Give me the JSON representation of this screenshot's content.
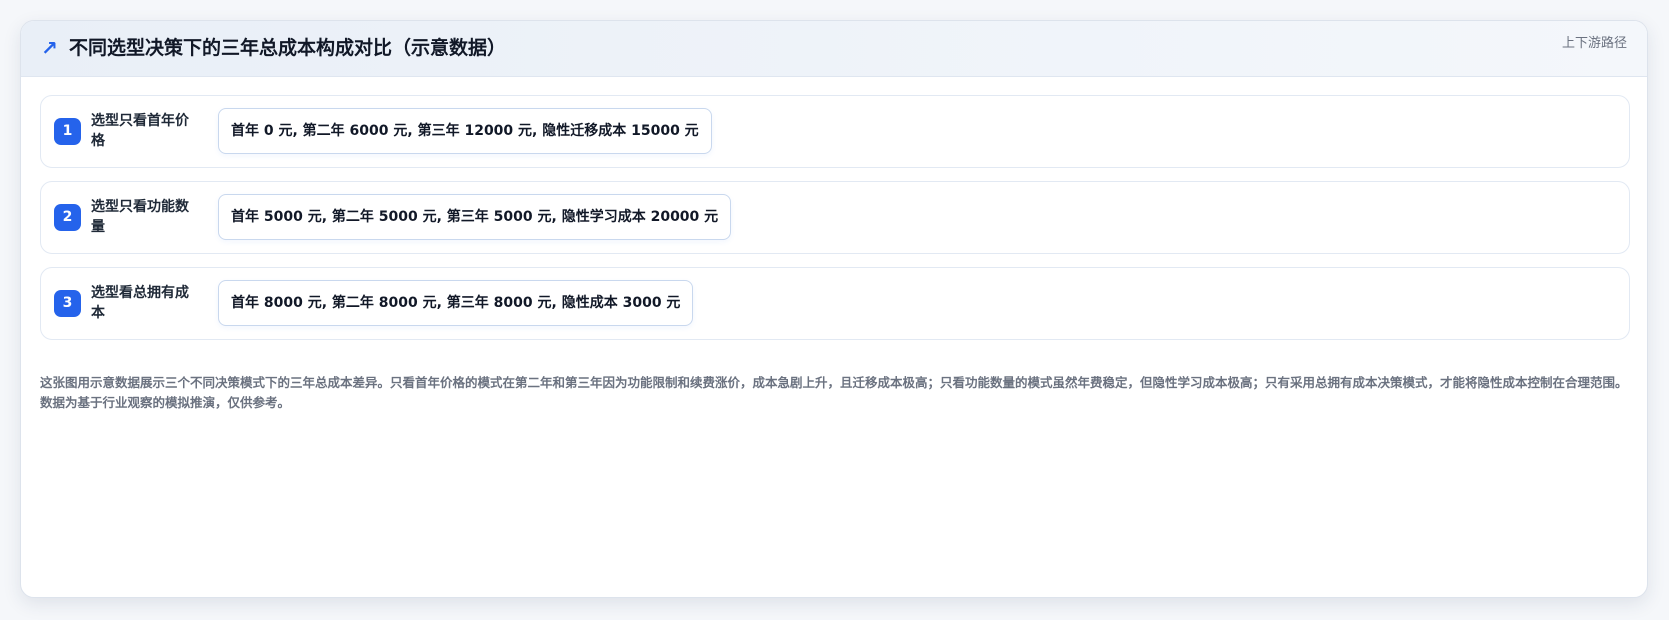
{
  "header": {
    "icon": "trend-arrow-icon",
    "title": "不同选型决策下的三年总成本构成对比（示意数据）",
    "link_label": "上下游路径"
  },
  "rows": [
    {
      "number": "1",
      "label": "选型只看首年价格",
      "detail": "首年 0 元, 第二年 6000 元, 第三年 12000 元, 隐性迁移成本 15000 元"
    },
    {
      "number": "2",
      "label": "选型只看功能数量",
      "detail": "首年 5000 元, 第二年 5000 元, 第三年 5000 元, 隐性学习成本 20000 元"
    },
    {
      "number": "3",
      "label": "选型看总拥有成本",
      "detail": "首年 8000 元, 第二年 8000 元, 第三年 8000 元, 隐性成本 3000 元"
    }
  ],
  "description": "这张图用示意数据展示三个不同决策模式下的三年总成本差异。只看首年价格的模式在第二年和第三年因为功能限制和续费涨价，成本急剧上升，且迁移成本极高；只看功能数量的模式虽然年费稳定，但隐性学习成本极高；只有采用总拥有成本决策模式，才能将隐性成本控制在合理范围。数据为基于行业观察的模拟推演，仅供参考。",
  "colors": {
    "accent": "#2563eb",
    "title_text": "#111827",
    "muted_text": "#6b7280"
  }
}
